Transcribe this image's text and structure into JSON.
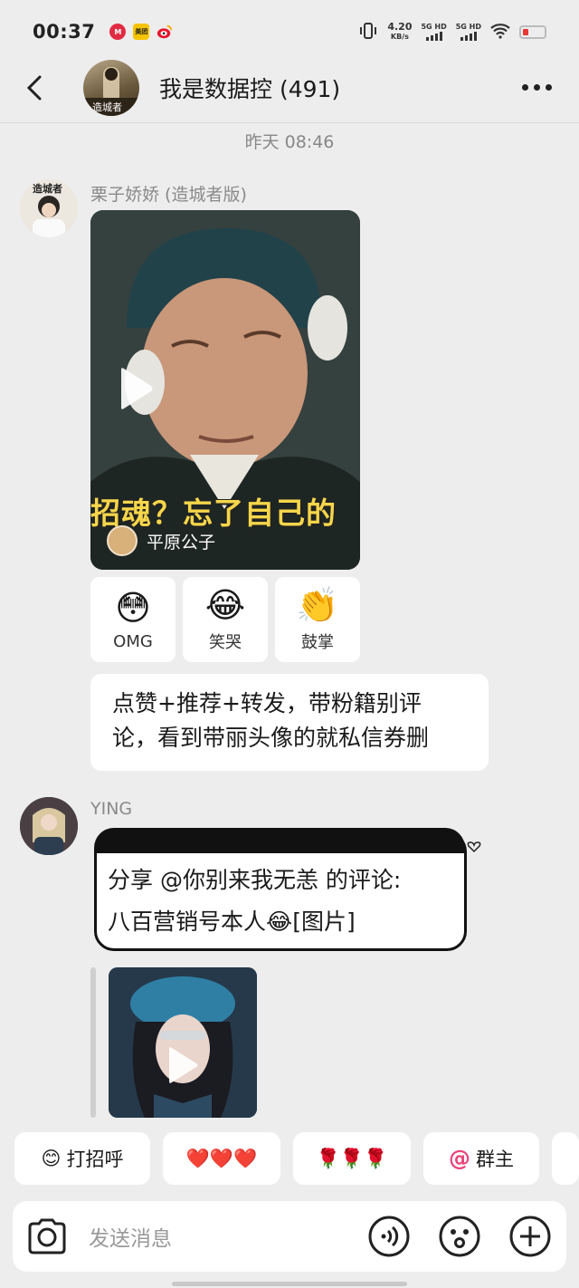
{
  "status_bar": {
    "time": "00:37",
    "app_icons": [
      "meituan-icon",
      "weibo-icon"
    ],
    "meituan_label": "美团",
    "net_speed": "4.20",
    "net_unit": "KB/s",
    "sim1": "5G HD",
    "sim2": "5G HD",
    "battery_color": "#e53935"
  },
  "header": {
    "title": "我是数据控 (491)",
    "avatar_caption": "造城者"
  },
  "timestamp": "昨天 08:46",
  "messages": [
    {
      "sender": "栗子娇娇 (造城者版)",
      "avatar_caption": "造城者",
      "video": {
        "caption": "招魂？忘了自己的",
        "author": "平原公子"
      },
      "reactions": [
        {
          "emoji": "😳",
          "label": "OMG"
        },
        {
          "emoji": "😂",
          "label": "笑哭"
        },
        {
          "emoji": "👏",
          "label": "鼓掌"
        }
      ],
      "text_line1": "点赞+推荐+转发，带粉籍别评",
      "text_line2": "论，看到带丽头像的就私信券删"
    },
    {
      "sender": "YING",
      "quote_line1": "分享 @你别来我无恙 的评论:",
      "quote_line2": "八百营销号本人😂[图片]"
    }
  ],
  "quick_replies": [
    {
      "icon": "😊",
      "label": "打招呼"
    },
    {
      "icon": "",
      "label": "❤️❤️❤️"
    },
    {
      "icon": "",
      "label": "🌹🌹🌹"
    },
    {
      "icon": "@",
      "label": "群主"
    }
  ],
  "input": {
    "placeholder": "发送消息"
  },
  "colors": {
    "background": "#ededed",
    "caption_yellow": "#f6d64a",
    "at_pink": "#e8457a"
  }
}
